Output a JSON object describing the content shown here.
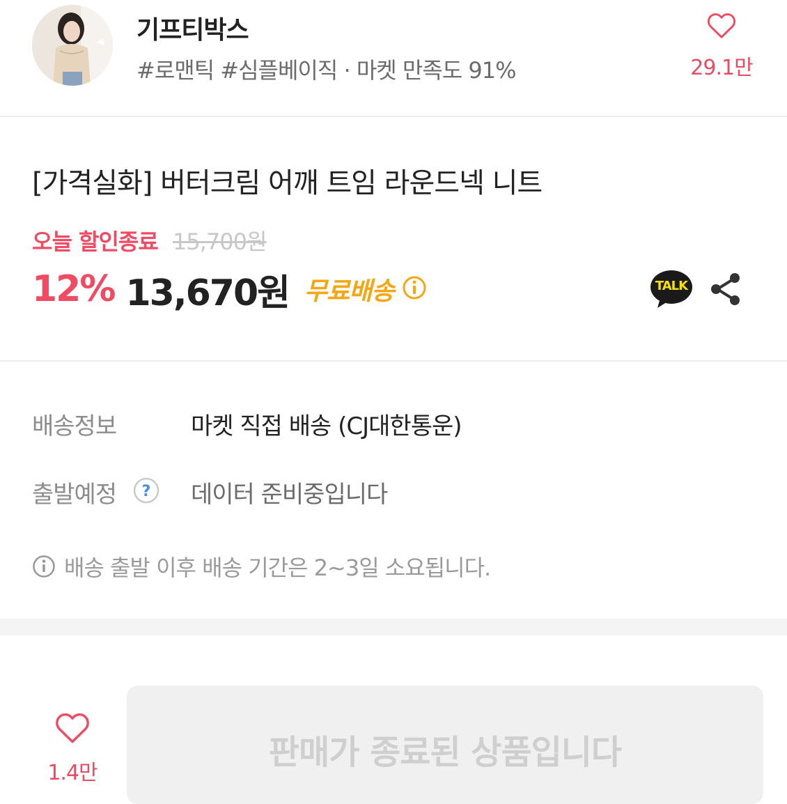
{
  "header": {
    "shop_name": "기프티박스",
    "tags": "#로맨틱 #심플베이직 · 마켓 만족도 91%",
    "favorite_count": "29.1만",
    "favorite_icon": "heart-outline-icon"
  },
  "product": {
    "title": "[가격실화] 버터크림 어깨 트임 라운드넥 니트",
    "sale_label": "오늘 할인종료",
    "original_price": "15,700원",
    "discount": "12%",
    "price": "13,670원",
    "free_shipping": "무료배송",
    "talk_label": "TALK"
  },
  "shipping": {
    "info_label": "배송정보",
    "info_value": "마켓 직접 배송 (CJ대한통운)",
    "depart_label": "출발예정",
    "depart_value": "데이터 준비중입니다",
    "notice": "배송 출발 이후 배송 기간은 2~3일 소요됩니다."
  },
  "bottom": {
    "like_count": "1.4만",
    "ended_label": "판매가 종료된 상품입니다"
  },
  "colors": {
    "accent_pink": "#ef4c63",
    "free_ship_orange": "#f5a612",
    "kakao_yellow": "#f9e000"
  }
}
